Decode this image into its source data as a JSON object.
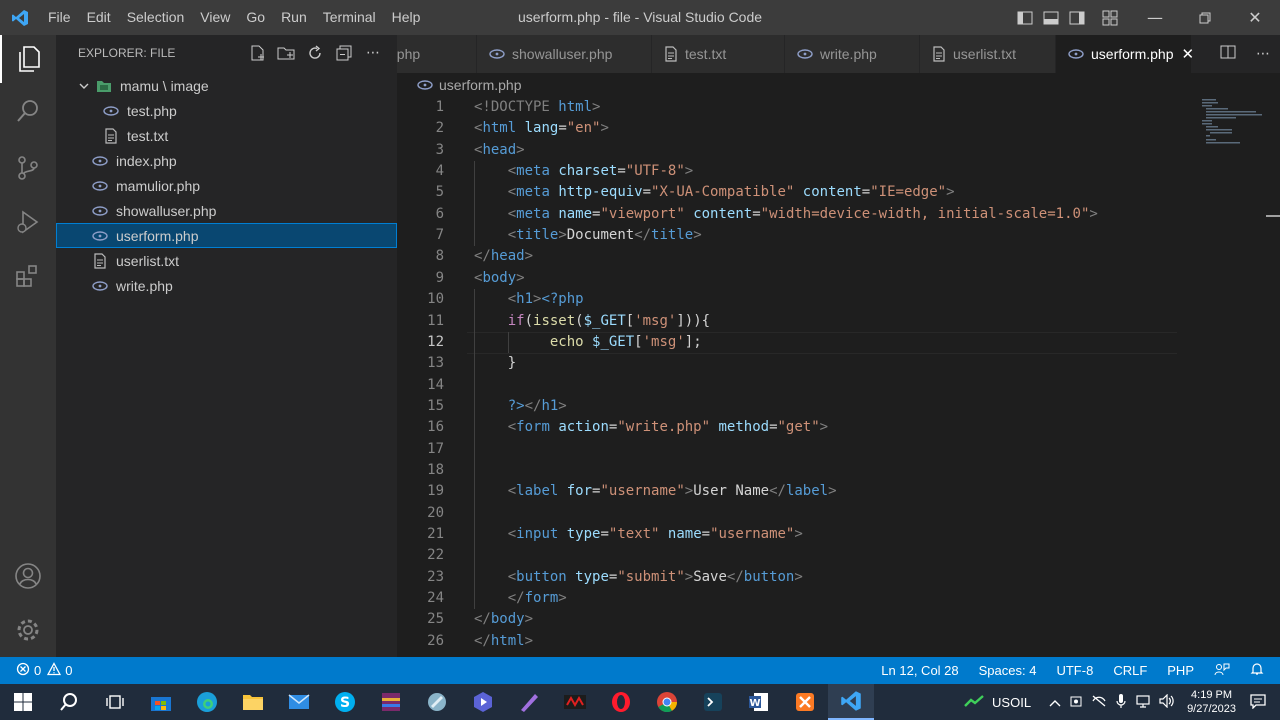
{
  "window": {
    "title": "userform.php - file - Visual Studio Code",
    "menu": [
      "File",
      "Edit",
      "Selection",
      "View",
      "Go",
      "Run",
      "Terminal",
      "Help"
    ]
  },
  "sidebar": {
    "header": "EXPLORER: FILE",
    "folder": "mamu \\ image",
    "items": [
      {
        "label": "test.php",
        "icon": "php-icon",
        "indent": 2
      },
      {
        "label": "test.txt",
        "icon": "txt-icon",
        "indent": 2
      },
      {
        "label": "index.php",
        "icon": "php-icon",
        "indent": 1
      },
      {
        "label": "mamulior.php",
        "icon": "php-icon",
        "indent": 1
      },
      {
        "label": "showalluser.php",
        "icon": "php-icon",
        "indent": 1
      },
      {
        "label": "userform.php",
        "icon": "php-icon",
        "indent": 1,
        "selected": true
      },
      {
        "label": "userlist.txt",
        "icon": "txt-icon",
        "indent": 1
      },
      {
        "label": "write.php",
        "icon": "php-icon",
        "indent": 1
      }
    ]
  },
  "tabs": [
    {
      "label": "t.php",
      "icon": "none"
    },
    {
      "label": "showalluser.php",
      "icon": "php-icon"
    },
    {
      "label": "test.txt",
      "icon": "txt-icon"
    },
    {
      "label": "write.php",
      "icon": "php-icon"
    },
    {
      "label": "userlist.txt",
      "icon": "txt-icon"
    },
    {
      "label": "userform.php",
      "icon": "php-icon",
      "active": true
    }
  ],
  "breadcrumb": "userform.php",
  "editor": {
    "current_line": 12,
    "lines": [
      [
        [
          "p",
          "<!DOCTYPE "
        ],
        [
          "t",
          "html"
        ],
        [
          "p",
          ">"
        ]
      ],
      [
        [
          "p",
          "<"
        ],
        [
          "t",
          "html"
        ],
        [
          "x",
          " "
        ],
        [
          "a",
          "lang"
        ],
        [
          "x",
          "="
        ],
        [
          "s",
          "\"en\""
        ],
        [
          "p",
          ">"
        ]
      ],
      [
        [
          "p",
          "<"
        ],
        [
          "t",
          "head"
        ],
        [
          "p",
          ">"
        ]
      ],
      [
        [
          "x",
          "    "
        ],
        [
          "p",
          "<"
        ],
        [
          "t",
          "meta"
        ],
        [
          "x",
          " "
        ],
        [
          "a",
          "charset"
        ],
        [
          "x",
          "="
        ],
        [
          "s",
          "\"UTF-8\""
        ],
        [
          "p",
          ">"
        ]
      ],
      [
        [
          "x",
          "    "
        ],
        [
          "p",
          "<"
        ],
        [
          "t",
          "meta"
        ],
        [
          "x",
          " "
        ],
        [
          "a",
          "http-equiv"
        ],
        [
          "x",
          "="
        ],
        [
          "s",
          "\"X-UA-Compatible\""
        ],
        [
          "x",
          " "
        ],
        [
          "a",
          "content"
        ],
        [
          "x",
          "="
        ],
        [
          "s",
          "\"IE=edge\""
        ],
        [
          "p",
          ">"
        ]
      ],
      [
        [
          "x",
          "    "
        ],
        [
          "p",
          "<"
        ],
        [
          "t",
          "meta"
        ],
        [
          "x",
          " "
        ],
        [
          "a",
          "name"
        ],
        [
          "x",
          "="
        ],
        [
          "s",
          "\"viewport\""
        ],
        [
          "x",
          " "
        ],
        [
          "a",
          "content"
        ],
        [
          "x",
          "="
        ],
        [
          "s",
          "\"width=device-width, initial-scale=1.0\""
        ],
        [
          "p",
          ">"
        ]
      ],
      [
        [
          "x",
          "    "
        ],
        [
          "p",
          "<"
        ],
        [
          "t",
          "title"
        ],
        [
          "p",
          ">"
        ],
        [
          "x",
          "Document"
        ],
        [
          "p",
          "</"
        ],
        [
          "t",
          "title"
        ],
        [
          "p",
          ">"
        ]
      ],
      [
        [
          "p",
          "</"
        ],
        [
          "t",
          "head"
        ],
        [
          "p",
          ">"
        ]
      ],
      [
        [
          "p",
          "<"
        ],
        [
          "t",
          "body"
        ],
        [
          "p",
          ">"
        ]
      ],
      [
        [
          "x",
          "    "
        ],
        [
          "p",
          "<"
        ],
        [
          "t",
          "h1"
        ],
        [
          "p",
          ">"
        ],
        [
          "h",
          "<?php"
        ]
      ],
      [
        [
          "x",
          "    "
        ],
        [
          "k",
          "if"
        ],
        [
          "x",
          "("
        ],
        [
          "f",
          "isset"
        ],
        [
          "x",
          "("
        ],
        [
          "v",
          "$_GET"
        ],
        [
          "x",
          "["
        ],
        [
          "s",
          "'msg'"
        ],
        [
          "x",
          "])){"
        ]
      ],
      [
        [
          "x",
          "         "
        ],
        [
          "f",
          "echo"
        ],
        [
          "x",
          " "
        ],
        [
          "v",
          "$_GET"
        ],
        [
          "x",
          "["
        ],
        [
          "s",
          "'msg'"
        ],
        [
          "x",
          "];"
        ]
      ],
      [
        [
          "x",
          "    }"
        ]
      ],
      [],
      [
        [
          "x",
          "    "
        ],
        [
          "h",
          "?>"
        ],
        [
          "p",
          "</"
        ],
        [
          "t",
          "h1"
        ],
        [
          "p",
          ">"
        ]
      ],
      [
        [
          "x",
          "    "
        ],
        [
          "p",
          "<"
        ],
        [
          "t",
          "form"
        ],
        [
          "x",
          " "
        ],
        [
          "a",
          "action"
        ],
        [
          "x",
          "="
        ],
        [
          "s",
          "\"write.php\""
        ],
        [
          "x",
          " "
        ],
        [
          "a",
          "method"
        ],
        [
          "x",
          "="
        ],
        [
          "s",
          "\"get\""
        ],
        [
          "p",
          ">"
        ]
      ],
      [],
      [],
      [
        [
          "x",
          "    "
        ],
        [
          "p",
          "<"
        ],
        [
          "t",
          "label"
        ],
        [
          "x",
          " "
        ],
        [
          "a",
          "for"
        ],
        [
          "x",
          "="
        ],
        [
          "s",
          "\"username\""
        ],
        [
          "p",
          ">"
        ],
        [
          "x",
          "User Name"
        ],
        [
          "p",
          "</"
        ],
        [
          "t",
          "label"
        ],
        [
          "p",
          ">"
        ]
      ],
      [],
      [
        [
          "x",
          "    "
        ],
        [
          "p",
          "<"
        ],
        [
          "t",
          "input"
        ],
        [
          "x",
          " "
        ],
        [
          "a",
          "type"
        ],
        [
          "x",
          "="
        ],
        [
          "s",
          "\"text\""
        ],
        [
          "x",
          " "
        ],
        [
          "a",
          "name"
        ],
        [
          "x",
          "="
        ],
        [
          "s",
          "\"username\""
        ],
        [
          "p",
          ">"
        ]
      ],
      [],
      [
        [
          "x",
          "    "
        ],
        [
          "p",
          "<"
        ],
        [
          "t",
          "button"
        ],
        [
          "x",
          " "
        ],
        [
          "a",
          "type"
        ],
        [
          "x",
          "="
        ],
        [
          "s",
          "\"submit\""
        ],
        [
          "p",
          ">"
        ],
        [
          "x",
          "Save"
        ],
        [
          "p",
          "</"
        ],
        [
          "t",
          "button"
        ],
        [
          "p",
          ">"
        ]
      ],
      [
        [
          "x",
          "    "
        ],
        [
          "p",
          "</"
        ],
        [
          "t",
          "form"
        ],
        [
          "p",
          ">"
        ]
      ],
      [
        [
          "p",
          "</"
        ],
        [
          "t",
          "body"
        ],
        [
          "p",
          ">"
        ]
      ],
      [
        [
          "p",
          "</"
        ],
        [
          "t",
          "html"
        ],
        [
          "p",
          ">"
        ]
      ]
    ]
  },
  "status": {
    "errors": "0",
    "warnings": "0",
    "position": "Ln 12, Col 28",
    "spaces": "Spaces: 4",
    "encoding": "UTF-8",
    "eol": "CRLF",
    "language": "PHP"
  },
  "taskbar": {
    "weather": "USOIL",
    "time": "4:19 PM",
    "date": "9/27/2023"
  }
}
